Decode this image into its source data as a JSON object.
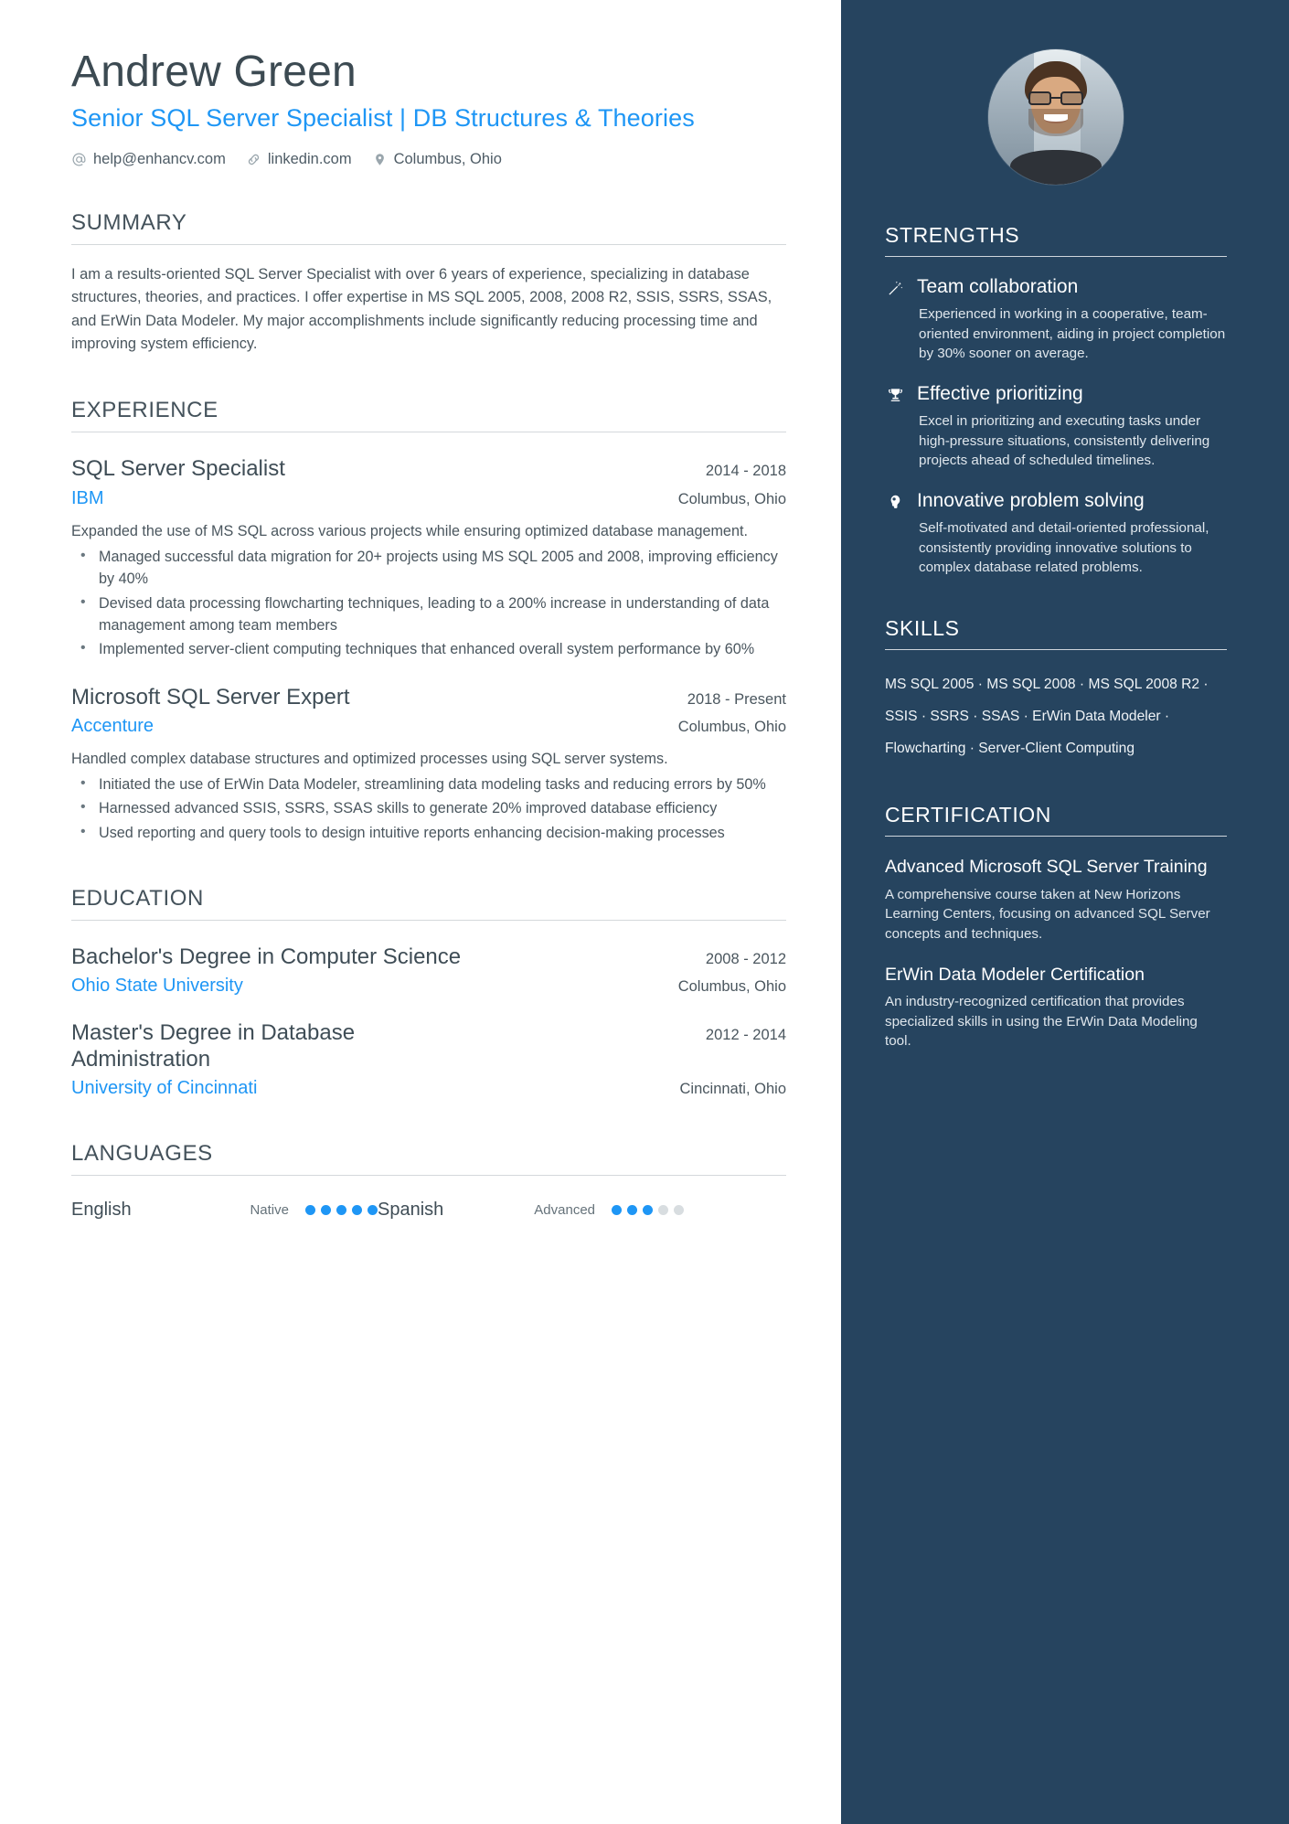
{
  "header": {
    "name": "Andrew Green",
    "headline": "Senior SQL Server Specialist | DB Structures & Theories",
    "contacts": [
      {
        "icon": "at-icon",
        "text": "help@enhancv.com"
      },
      {
        "icon": "link-icon",
        "text": "linkedin.com"
      },
      {
        "icon": "location-pin-icon",
        "text": "Columbus, Ohio"
      }
    ]
  },
  "summary": {
    "title": "SUMMARY",
    "text": "I am a results-oriented SQL Server Specialist with over 6 years of experience, specializing in database structures, theories, and practices. I offer expertise in MS SQL 2005, 2008, 2008 R2, SSIS, SSRS, SSAS, and ErWin Data Modeler. My major accomplishments include significantly reducing processing time and improving system efficiency."
  },
  "experience": {
    "title": "EXPERIENCE",
    "entries": [
      {
        "title": "SQL Server Specialist",
        "dates": "2014 - 2018",
        "org": "IBM",
        "location": "Columbus, Ohio",
        "description": "Expanded the use of MS SQL across various projects while ensuring optimized database management.",
        "bullets": [
          "Managed successful data migration for 20+ projects using MS SQL 2005 and 2008, improving efficiency by 40%",
          "Devised data processing flowcharting techniques, leading to a 200% increase in understanding of data management among team members",
          "Implemented server-client computing techniques that enhanced overall system performance by 60%"
        ]
      },
      {
        "title": "Microsoft SQL Server Expert",
        "dates": "2018 - Present",
        "org": "Accenture",
        "location": "Columbus, Ohio",
        "description": "Handled complex database structures and optimized processes using SQL server systems.",
        "bullets": [
          "Initiated the use of ErWin Data Modeler, streamlining data modeling tasks and reducing errors by 50%",
          "Harnessed advanced SSIS, SSRS, SSAS skills to generate 20% improved database efficiency",
          "Used reporting and query tools to design intuitive reports enhancing decision-making processes"
        ]
      }
    ]
  },
  "education": {
    "title": "EDUCATION",
    "entries": [
      {
        "title": "Bachelor's Degree in Computer Science",
        "dates": "2008 - 2012",
        "org": "Ohio State University",
        "location": "Columbus, Ohio"
      },
      {
        "title": "Master's Degree in Database Administration",
        "dates": "2012 - 2014",
        "org": "University of Cincinnati",
        "location": "Cincinnati, Ohio"
      }
    ]
  },
  "languages": {
    "title": "LANGUAGES",
    "items": [
      {
        "name": "English",
        "level": "Native",
        "filled": 5,
        "total": 5
      },
      {
        "name": "Spanish",
        "level": "Advanced",
        "filled": 3,
        "total": 5
      }
    ]
  },
  "sidebar": {
    "strengths": {
      "title": "STRENGTHS",
      "items": [
        {
          "icon": "magic-wand-icon",
          "title": "Team collaboration",
          "description": "Experienced in working in a cooperative, team-oriented environment, aiding in project completion by 30% sooner on average."
        },
        {
          "icon": "trophy-icon",
          "title": "Effective prioritizing",
          "description": "Excel in prioritizing and executing tasks under high-pressure situations, consistently delivering projects ahead of scheduled timelines."
        },
        {
          "icon": "lightbulb-head-icon",
          "title": "Innovative problem solving",
          "description": "Self-motivated and detail-oriented professional, consistently providing innovative solutions to complex database related problems."
        }
      ]
    },
    "skills": {
      "title": "SKILLS",
      "text": "MS SQL 2005 · MS SQL 2008 · MS SQL 2008 R2 · SSIS · SSRS · SSAS · ErWin Data Modeler · Flowcharting · Server-Client Computing"
    },
    "certification": {
      "title": "CERTIFICATION",
      "items": [
        {
          "title": "Advanced Microsoft SQL Server Training",
          "description": "A comprehensive course taken at New Horizons Learning Centers, focusing on advanced SQL Server concepts and techniques."
        },
        {
          "title": "ErWin Data Modeler Certification",
          "description": "An industry-recognized certification that provides specialized skills in using the ErWin Data Modeling tool."
        }
      ]
    }
  },
  "colors": {
    "accent": "#1e96f5",
    "sidebar_bg": "#26445f",
    "text": "#4a565e",
    "heading": "#44525b"
  }
}
